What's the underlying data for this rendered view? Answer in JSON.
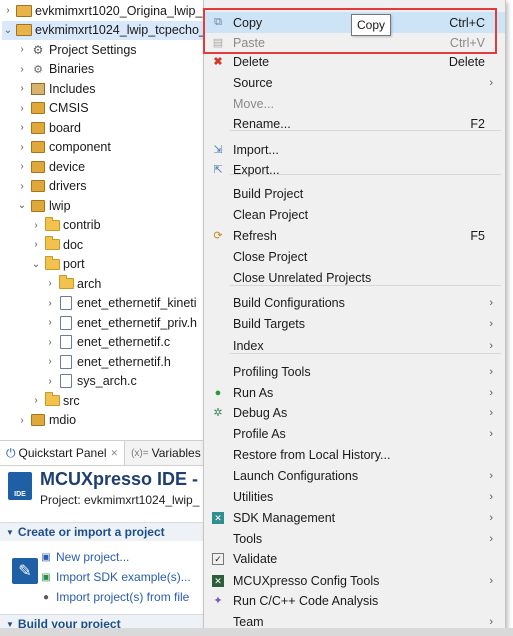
{
  "tree": {
    "items": [
      {
        "label": "evkmimxrt1020_Origina_lwip_",
        "twisty": "›",
        "icon": "project-icon",
        "indent": 0
      },
      {
        "label": "evkmimxrt1024_lwip_tcpecho_",
        "twisty": "⌄",
        "icon": "project-icon",
        "indent": 0
      },
      {
        "label": "Project Settings",
        "twisty": "›",
        "icon": "gear-icon",
        "indent": 1
      },
      {
        "label": "Binaries",
        "twisty": "›",
        "icon": "binaries-icon",
        "indent": 1
      },
      {
        "label": "Includes",
        "twisty": "›",
        "icon": "includes-icon",
        "indent": 1
      },
      {
        "label": "CMSIS",
        "twisty": "›",
        "icon": "package-icon",
        "indent": 1
      },
      {
        "label": "board",
        "twisty": "›",
        "icon": "package-icon",
        "indent": 1
      },
      {
        "label": "component",
        "twisty": "›",
        "icon": "package-icon",
        "indent": 1
      },
      {
        "label": "device",
        "twisty": "›",
        "icon": "package-icon",
        "indent": 1
      },
      {
        "label": "drivers",
        "twisty": "›",
        "icon": "package-icon",
        "indent": 1
      },
      {
        "label": "lwip",
        "twisty": "⌄",
        "icon": "package-icon",
        "indent": 1
      },
      {
        "label": "contrib",
        "twisty": "›",
        "icon": "folder-icon",
        "indent": 2
      },
      {
        "label": "doc",
        "twisty": "›",
        "icon": "folder-icon",
        "indent": 2
      },
      {
        "label": "port",
        "twisty": "⌄",
        "icon": "folder-icon",
        "indent": 2
      },
      {
        "label": "arch",
        "twisty": "›",
        "icon": "folder-icon",
        "indent": 3
      },
      {
        "label": "enet_ethernetif_kineti",
        "twisty": "›",
        "icon": "c-file-icon",
        "indent": 3
      },
      {
        "label": "enet_ethernetif_priv.h",
        "twisty": "›",
        "icon": "h-file-icon",
        "indent": 3
      },
      {
        "label": "enet_ethernetif.c",
        "twisty": "›",
        "icon": "c-file-icon",
        "indent": 3
      },
      {
        "label": "enet_ethernetif.h",
        "twisty": "›",
        "icon": "h-file-icon",
        "indent": 3
      },
      {
        "label": "sys_arch.c",
        "twisty": "›",
        "icon": "c-file-icon",
        "indent": 3
      },
      {
        "label": "src",
        "twisty": "›",
        "icon": "folder-icon",
        "indent": 2
      },
      {
        "label": "mdio",
        "twisty": "›",
        "icon": "package-icon",
        "indent": 1
      }
    ]
  },
  "quickstart": {
    "tabs": [
      {
        "label": "Quickstart Panel",
        "icon": "quickstart-icon"
      },
      {
        "label": "Variables",
        "icon": "variables-icon"
      }
    ],
    "title": "MCUXpresso IDE - Q",
    "logo_text": "IDE",
    "project_line": "Project: evkmimxrt1024_lwip_",
    "section_create": "Create or import a project",
    "links": [
      "New project...",
      "Import SDK example(s)...",
      "Import project(s) from file"
    ],
    "section_build": "Build your project"
  },
  "menu": {
    "items": [
      {
        "label": "Copy",
        "shortcut": "Ctrl+C",
        "icon": "copy-icon",
        "disabled": false,
        "submenu": false
      },
      {
        "label": "Paste",
        "shortcut": "Ctrl+V",
        "icon": "paste-icon",
        "disabled": true,
        "submenu": false
      },
      {
        "label": "Delete",
        "shortcut": "Delete",
        "icon": "delete-icon",
        "disabled": false,
        "submenu": false
      },
      {
        "label": "Source",
        "shortcut": "",
        "icon": "",
        "disabled": false,
        "submenu": true
      },
      {
        "label": "Move...",
        "shortcut": "",
        "icon": "",
        "disabled": true,
        "submenu": false
      },
      {
        "label": "Rename...",
        "shortcut": "F2",
        "icon": "",
        "disabled": false,
        "submenu": false
      },
      {
        "label": "Import...",
        "shortcut": "",
        "icon": "import-icon",
        "disabled": false,
        "submenu": false
      },
      {
        "label": "Export...",
        "shortcut": "",
        "icon": "export-icon",
        "disabled": false,
        "submenu": false
      },
      {
        "label": "Build Project",
        "shortcut": "",
        "icon": "",
        "disabled": false,
        "submenu": false
      },
      {
        "label": "Clean Project",
        "shortcut": "",
        "icon": "",
        "disabled": false,
        "submenu": false
      },
      {
        "label": "Refresh",
        "shortcut": "F5",
        "icon": "refresh-icon",
        "disabled": false,
        "submenu": false
      },
      {
        "label": "Close Project",
        "shortcut": "",
        "icon": "",
        "disabled": false,
        "submenu": false
      },
      {
        "label": "Close Unrelated Projects",
        "shortcut": "",
        "icon": "",
        "disabled": false,
        "submenu": false
      },
      {
        "label": "Build Configurations",
        "shortcut": "",
        "icon": "",
        "disabled": false,
        "submenu": true
      },
      {
        "label": "Build Targets",
        "shortcut": "",
        "icon": "",
        "disabled": false,
        "submenu": true
      },
      {
        "label": "Index",
        "shortcut": "",
        "icon": "",
        "disabled": false,
        "submenu": true
      },
      {
        "label": "Profiling Tools",
        "shortcut": "",
        "icon": "",
        "disabled": false,
        "submenu": true
      },
      {
        "label": "Run As",
        "shortcut": "",
        "icon": "run-icon",
        "disabled": false,
        "submenu": true
      },
      {
        "label": "Debug As",
        "shortcut": "",
        "icon": "debug-icon",
        "disabled": false,
        "submenu": true
      },
      {
        "label": "Profile As",
        "shortcut": "",
        "icon": "",
        "disabled": false,
        "submenu": true
      },
      {
        "label": "Restore from Local History...",
        "shortcut": "",
        "icon": "",
        "disabled": false,
        "submenu": false
      },
      {
        "label": "Launch Configurations",
        "shortcut": "",
        "icon": "",
        "disabled": false,
        "submenu": true
      },
      {
        "label": "Utilities",
        "shortcut": "",
        "icon": "",
        "disabled": false,
        "submenu": true
      },
      {
        "label": "SDK Management",
        "shortcut": "",
        "icon": "sdk-icon",
        "disabled": false,
        "submenu": true
      },
      {
        "label": "Tools",
        "shortcut": "",
        "icon": "",
        "disabled": false,
        "submenu": true
      },
      {
        "label": "Validate",
        "shortcut": "",
        "icon": "checkbox-icon",
        "disabled": false,
        "submenu": false
      },
      {
        "label": "MCUXpresso Config Tools",
        "shortcut": "",
        "icon": "config-tools-icon",
        "disabled": false,
        "submenu": true
      },
      {
        "label": "Run C/C++ Code Analysis",
        "shortcut": "",
        "icon": "code-analysis-icon",
        "disabled": false,
        "submenu": false
      },
      {
        "label": "Team",
        "shortcut": "",
        "icon": "",
        "disabled": false,
        "submenu": true
      }
    ],
    "tooltip": "Copy"
  },
  "colors": {
    "highlight_border": "#e13b3b",
    "link": "#2a5db0",
    "section": "#1a4f8c"
  }
}
